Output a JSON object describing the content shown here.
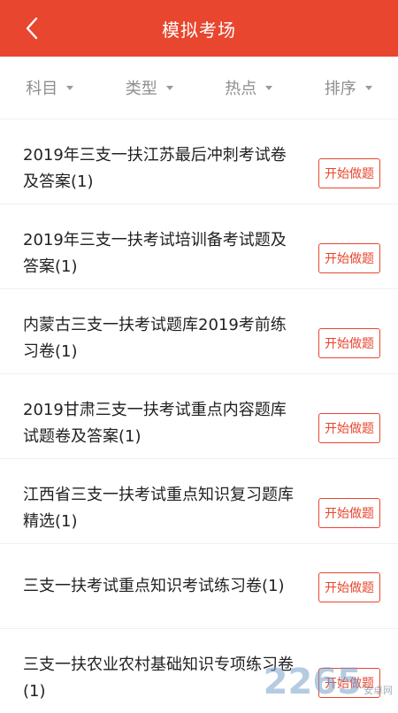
{
  "header": {
    "title": "模拟考场",
    "back_icon": "chevron-left-icon",
    "background_color": "#e8462e"
  },
  "filters": [
    {
      "label": "科目"
    },
    {
      "label": "类型"
    },
    {
      "label": "热点"
    },
    {
      "label": "排序"
    }
  ],
  "items": [
    {
      "title": "2019年三支一扶江苏最后冲刺考试卷及答案(1)",
      "button_label": "开始做题"
    },
    {
      "title": "2019年三支一扶考试培训备考试题及答案(1)",
      "button_label": "开始做题"
    },
    {
      "title": "内蒙古三支一扶考试题库2019考前练习卷(1)",
      "button_label": "开始做题"
    },
    {
      "title": "2019甘肃三支一扶考试重点内容题库试题卷及答案(1)",
      "button_label": "开始做题"
    },
    {
      "title": "江西省三支一扶考试重点知识复习题库精选(1)",
      "button_label": "开始做题"
    },
    {
      "title": "三支一扶考试重点知识考试练习卷(1)",
      "button_label": "开始做题"
    },
    {
      "title": "三支一扶农业农村基础知识专项练习卷(1)",
      "button_label": "开始做题"
    }
  ],
  "watermark": {
    "text": "2265",
    "sub": "安卓网"
  },
  "accent_color": "#e8462e"
}
